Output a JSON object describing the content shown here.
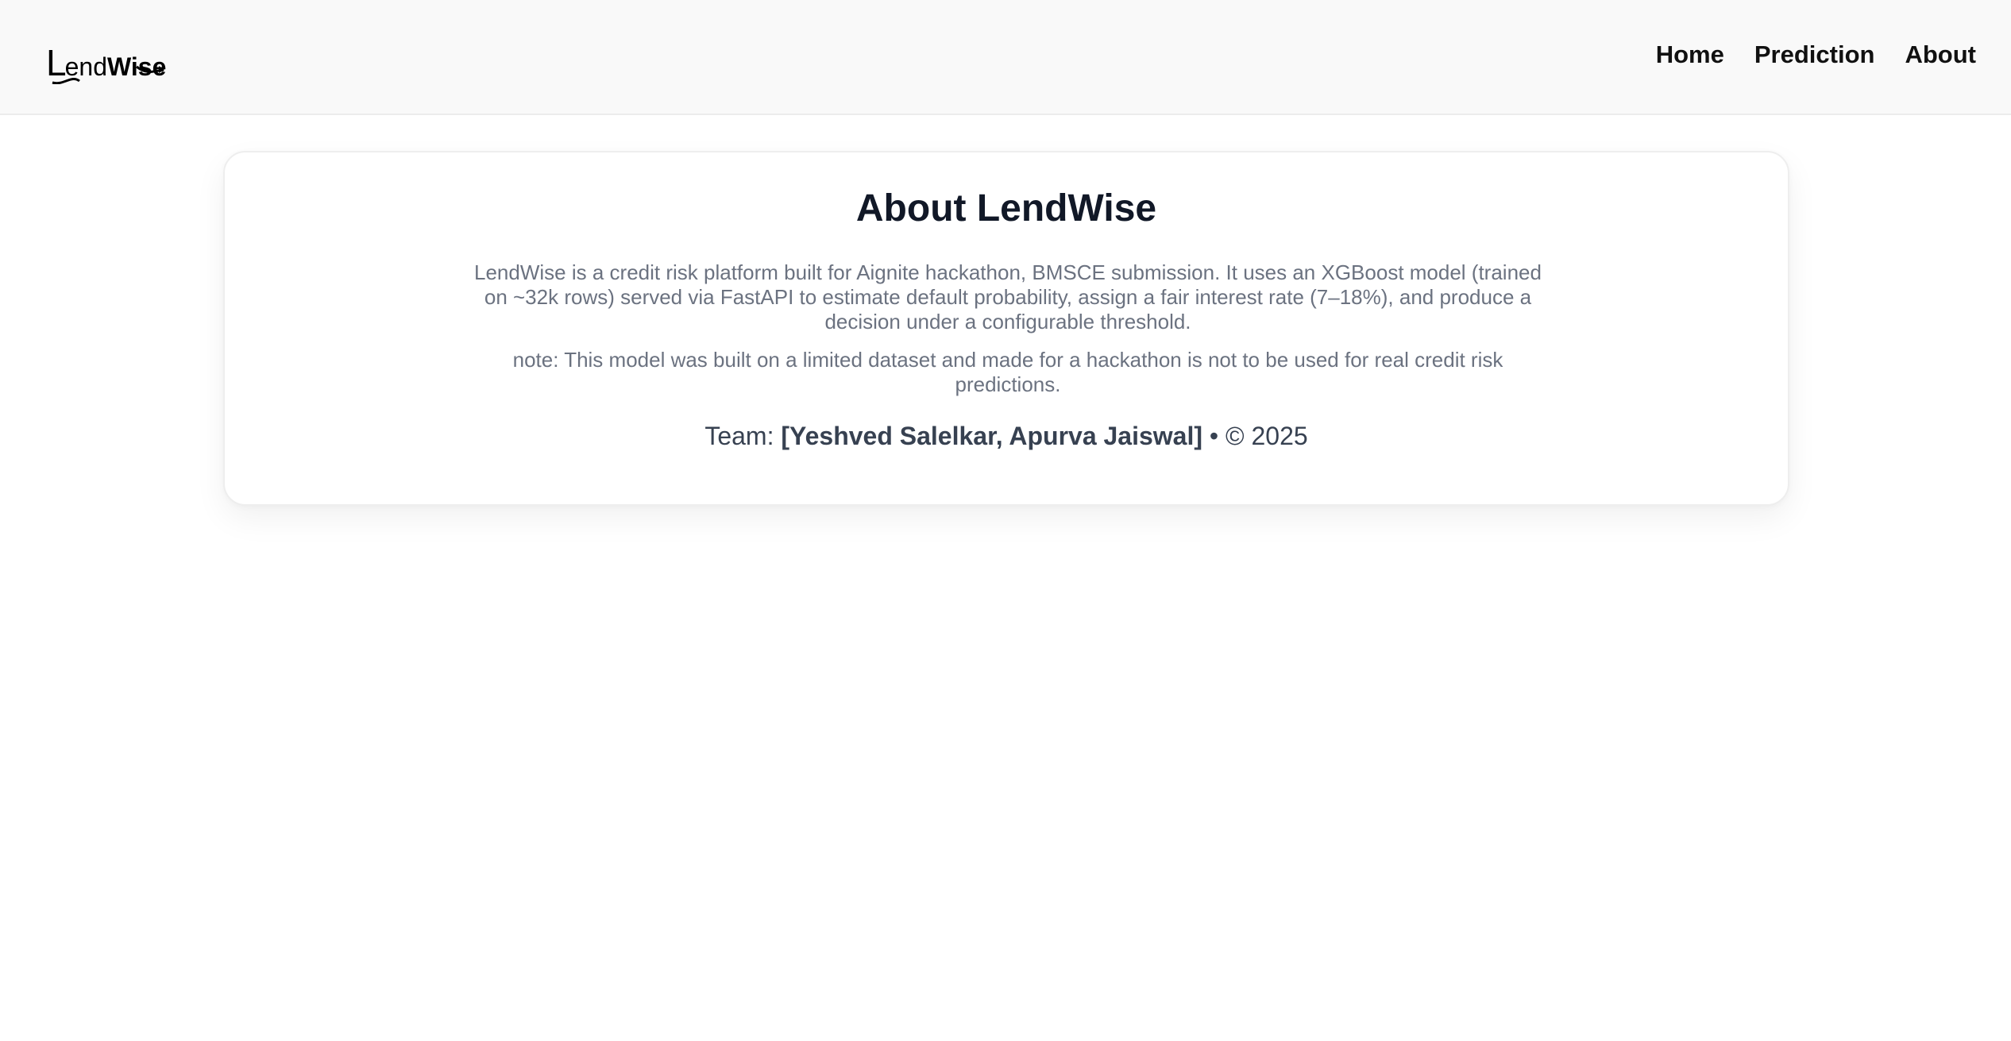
{
  "navbar": {
    "logo": {
      "part_l": "L",
      "part_end": "end",
      "part_wise": "Wise"
    },
    "links": [
      {
        "label": "Home"
      },
      {
        "label": "Prediction"
      },
      {
        "label": "About"
      }
    ]
  },
  "about": {
    "title": "About LendWise",
    "description": "LendWise is a credit risk platform built for Aignite hackathon, BMSCE submission. It uses an XGBoost model (trained on ~32k rows) served via FastAPI to estimate default probability, assign a fair interest rate (7–18%), and produce a decision under a configurable threshold.",
    "note": "note: This model was built on a limited dataset and made for a hackathon is not to be used for real credit risk predictions.",
    "team_prefix": "Team: ",
    "team_names": "[Yeshved Salelkar, Apurva Jaiswal]",
    "team_suffix": " • © 2025"
  },
  "colors": {
    "navbar_bg": "#f9f9f9",
    "heading": "#111827",
    "body_text": "#6b7280",
    "team_text": "#374151"
  }
}
